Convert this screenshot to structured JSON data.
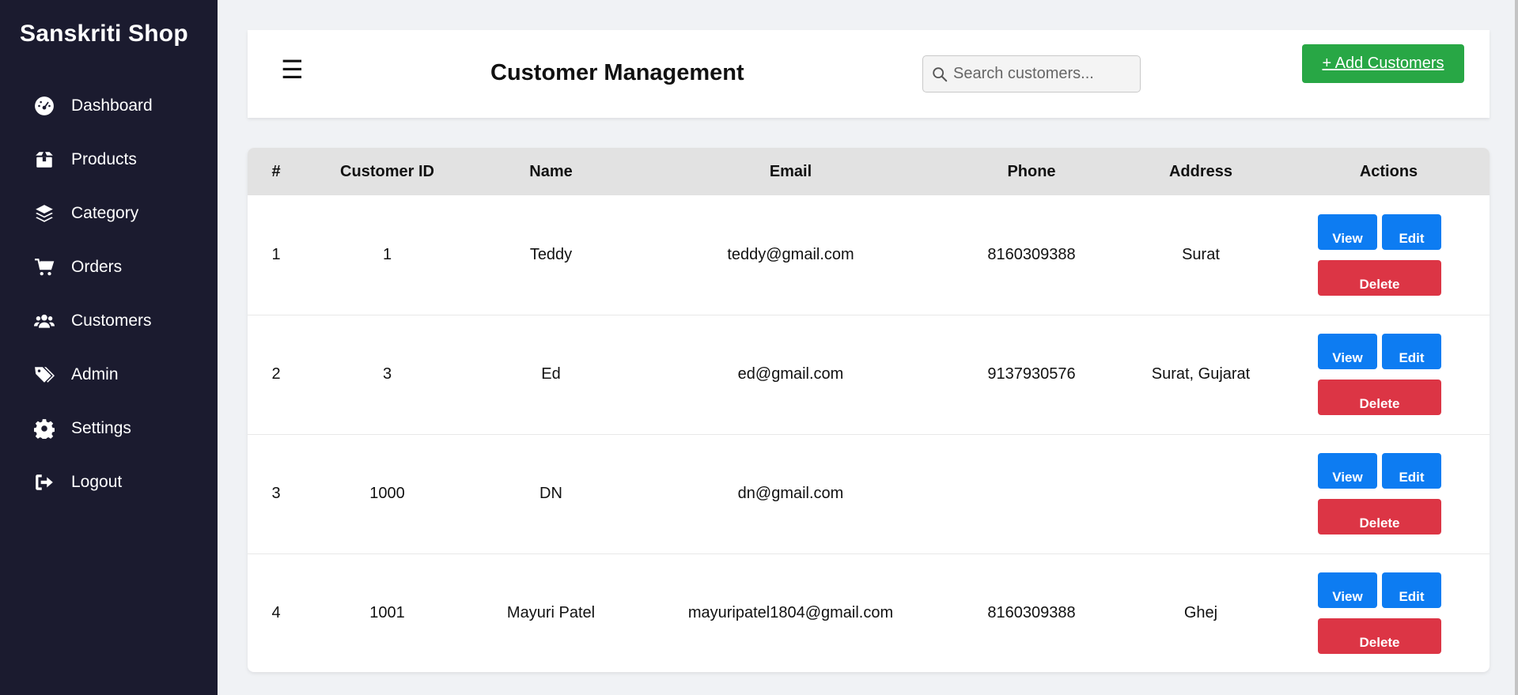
{
  "sidebar": {
    "brand": "Sanskriti Shop",
    "items": [
      {
        "label": "Dashboard",
        "icon": "dashboard-gauge-icon"
      },
      {
        "label": "Products",
        "icon": "box-icon"
      },
      {
        "label": "Category",
        "icon": "layers-icon"
      },
      {
        "label": "Orders",
        "icon": "cart-icon"
      },
      {
        "label": "Customers",
        "icon": "users-icon"
      },
      {
        "label": "Admin",
        "icon": "tags-icon"
      },
      {
        "label": "Settings",
        "icon": "gear-icon"
      },
      {
        "label": "Logout",
        "icon": "logout-icon"
      }
    ]
  },
  "header": {
    "menu_glyph": "☰",
    "title": "Customer Management",
    "search_placeholder": "Search customers...",
    "search_value": "",
    "add_button": "+ Add Customers"
  },
  "table": {
    "columns": [
      "#",
      "Customer ID",
      "Name",
      "Email",
      "Phone",
      "Address",
      "Actions"
    ],
    "rows": [
      {
        "num": "1",
        "id": "1",
        "name": "Teddy",
        "email": "teddy@gmail.com",
        "phone": "8160309388",
        "address": "Surat"
      },
      {
        "num": "2",
        "id": "3",
        "name": "Ed",
        "email": "ed@gmail.com",
        "phone": "9137930576",
        "address": "Surat, Gujarat"
      },
      {
        "num": "3",
        "id": "1000",
        "name": "DN",
        "email": "dn@gmail.com",
        "phone": "",
        "address": ""
      },
      {
        "num": "4",
        "id": "1001",
        "name": "Mayuri Patel",
        "email": "mayuripatel1804@gmail.com",
        "phone": "8160309388",
        "address": "Ghej"
      }
    ],
    "actions": {
      "view": "View",
      "edit": "Edit",
      "delete": "Delete"
    }
  },
  "colors": {
    "sidebar_bg": "#1b1b2f",
    "add_button": "#28a745",
    "view_edit": "#0d7cf2",
    "delete": "#dc3545",
    "table_header": "#e2e2e2",
    "page_bg": "#f0f2f5"
  }
}
